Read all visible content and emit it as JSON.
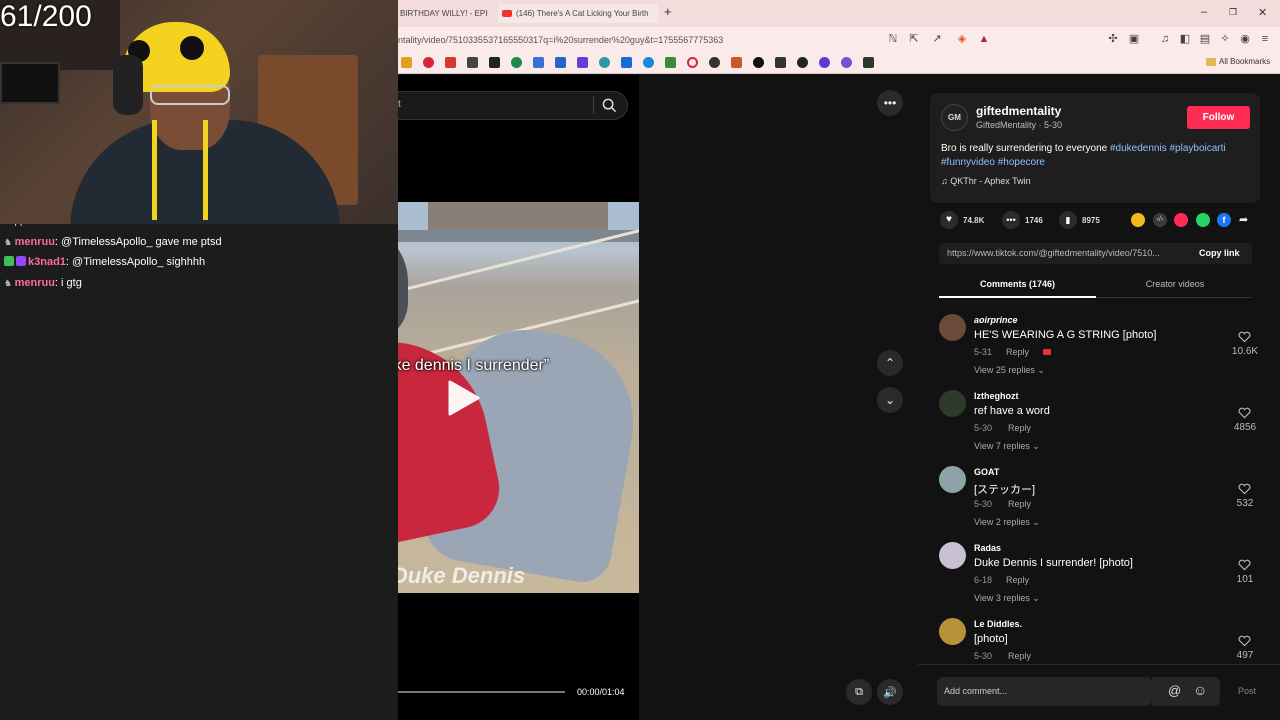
{
  "browser": {
    "tabs": [
      {
        "label": "BIRTHDAY WILLY! - EPIC"
      },
      {
        "label": "(146) There's A Cat Licking Your Birth"
      }
    ],
    "url": "ntality/video/7510335537165550317q=i%20surrender%20guy&t=1755567775363",
    "all_bookmarks": "All Bookmarks"
  },
  "overlay": {
    "counter": "61/200",
    "chat_partial": "dropped",
    "chat": [
      {
        "user": "menruu",
        "user_color": "#ff6aa5",
        "message": "@TimelessApollo_ gave me ptsd"
      },
      {
        "user": "k3nad1",
        "user_color": "#ff6aa5",
        "message": "@TimelessApollo_ sighhhh"
      },
      {
        "user": "menruu",
        "user_color": "#ff6aa5",
        "message": "i gtg"
      }
    ]
  },
  "search": {
    "text": "t"
  },
  "video": {
    "caption": "“Duke dennis I surrender”",
    "watermark": "Duke Dennis",
    "time": "00:00/01:04",
    "progress": 0.0
  },
  "author": {
    "avatar_text": "GM",
    "username": "giftedmentality",
    "display": "GiftedMentality · 5-30",
    "follow": "Follow"
  },
  "description": {
    "text": "Bro is really surrendering to everyone ",
    "tags": [
      "#dukedennis",
      "#playboicarti",
      "#funnyvideo",
      "#hopecore"
    ]
  },
  "music": "QKThr - Aphex Twin",
  "stats": {
    "likes": "74.8K",
    "comments": "1746",
    "saves": "8975"
  },
  "link": {
    "url": "https://www.tiktok.com/@giftedmentality/video/7510...",
    "copy": "Copy link"
  },
  "tabs": {
    "comments": "Comments (1746)",
    "creator": "Creator videos"
  },
  "comments": [
    {
      "user": "aoirprince",
      "text": "HE'S WEARING A G STRING [photo]",
      "date": "5-31",
      "reply": "Reply",
      "view": "View 25 replies",
      "likes": "10.6K",
      "avatar_color": "#6b4a3a"
    },
    {
      "user": "lztheghozt",
      "text": "ref have a word",
      "date": "5-30",
      "reply": "Reply",
      "view": "View 7 replies",
      "likes": "4856",
      "avatar_color": "#2e3a2a"
    },
    {
      "user": "GOAT",
      "text": "[ステッカー]",
      "date": "5-30",
      "reply": "Reply",
      "view": "View 2 replies",
      "likes": "532",
      "avatar_color": "#8ea3a8"
    },
    {
      "user": "Radas",
      "text": "Duke Dennis I surrender! [photo]",
      "date": "6-18",
      "reply": "Reply",
      "view": "View 3 replies",
      "likes": "101",
      "avatar_color": "#c9c0d6"
    },
    {
      "user": "Le Diddles.",
      "text": "[photo]",
      "date": "5-30",
      "reply": "Reply",
      "view": "",
      "likes": "497",
      "avatar_color": "#b8923a"
    }
  ],
  "comment_input": {
    "placeholder": "Add comment...",
    "post": "Post"
  },
  "colors": {
    "accent": "#fe2c55",
    "tag": "#8ec1ff",
    "chat_name": "#ff6aa5",
    "green_badge": "#3bbf5a",
    "purple_badge": "#9147ff"
  }
}
